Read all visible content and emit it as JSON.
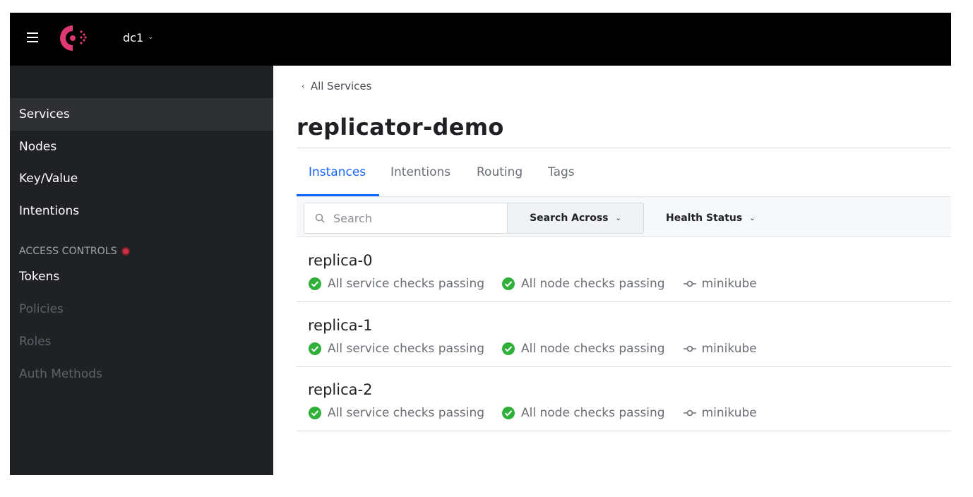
{
  "header": {
    "datacenter": "dc1",
    "colors": {
      "background": "#000000",
      "logo": "#e03875"
    }
  },
  "sidebar": {
    "items": [
      {
        "label": "Services",
        "active": true
      },
      {
        "label": "Nodes"
      },
      {
        "label": "Key/Value"
      },
      {
        "label": "Intentions"
      }
    ],
    "access_section": {
      "label": "ACCESS CONTROLS",
      "items": [
        {
          "label": "Tokens",
          "enabled": true
        },
        {
          "label": "Policies",
          "enabled": false
        },
        {
          "label": "Roles",
          "enabled": false
        },
        {
          "label": "Auth Methods",
          "enabled": false
        }
      ]
    }
  },
  "breadcrumb": {
    "label": "All Services"
  },
  "page": {
    "title": "replicator-demo"
  },
  "tabs": [
    {
      "label": "Instances",
      "active": true
    },
    {
      "label": "Intentions"
    },
    {
      "label": "Routing"
    },
    {
      "label": "Tags"
    }
  ],
  "filters": {
    "search_placeholder": "Search",
    "search_across": "Search Across",
    "health_status": "Health Status"
  },
  "instances": [
    {
      "name": "replica-0",
      "service_checks": "All service checks passing",
      "node_checks": "All node checks passing",
      "node": "minikube"
    },
    {
      "name": "replica-1",
      "service_checks": "All service checks passing",
      "node_checks": "All node checks passing",
      "node": "minikube"
    },
    {
      "name": "replica-2",
      "service_checks": "All service checks passing",
      "node_checks": "All node checks passing",
      "node": "minikube"
    }
  ],
  "colors": {
    "accent": "#1563ff",
    "passing": "#2eb039",
    "sidebar_bg": "#1f2124",
    "warning_dot": "#c73445"
  }
}
